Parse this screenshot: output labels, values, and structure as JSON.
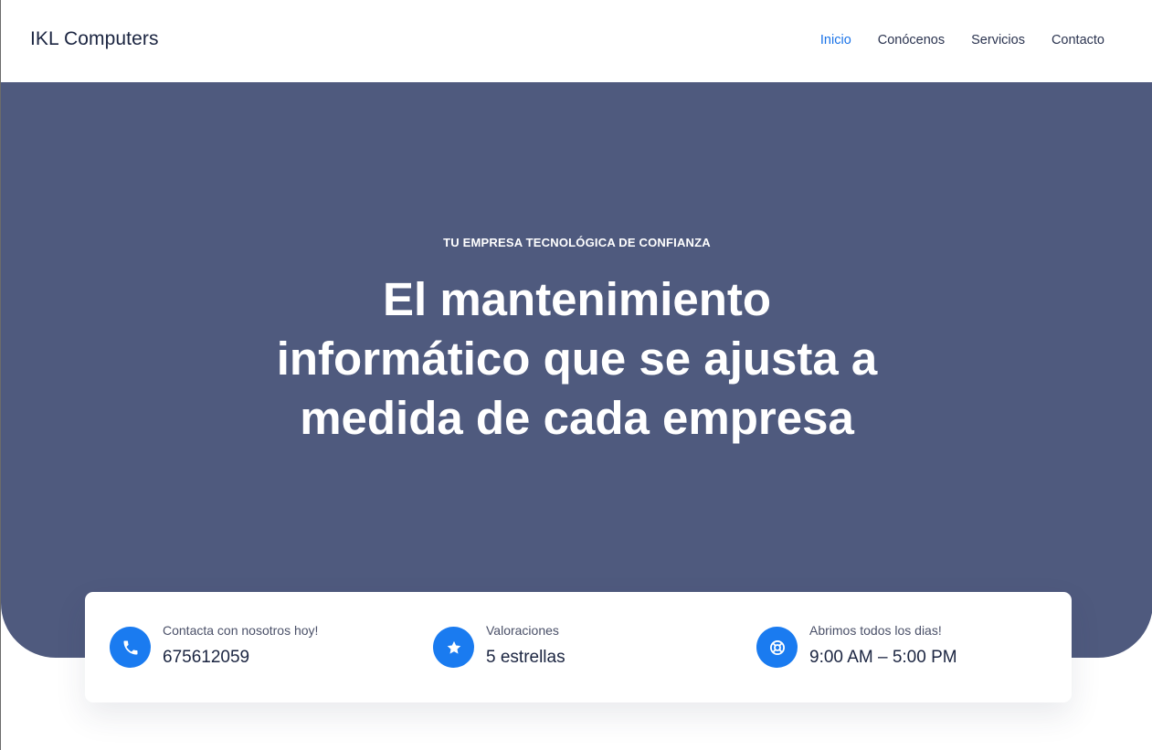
{
  "header": {
    "brand": "IKL Computers",
    "nav": [
      {
        "label": "Inicio",
        "active": true
      },
      {
        "label": "Conócenos",
        "active": false
      },
      {
        "label": "Servicios",
        "active": false
      },
      {
        "label": "Contacto",
        "active": false
      }
    ]
  },
  "hero": {
    "eyebrow": "TU EMPRESA TECNOLÓGICA DE CONFIANZA",
    "title": "El mantenimiento informático que se ajusta a medida de cada empresa"
  },
  "info": [
    {
      "icon": "phone-icon",
      "label": "Contacta con nosotros hoy!",
      "value": "675612059"
    },
    {
      "icon": "star-icon",
      "label": "Valoraciones",
      "value": "5 estrellas"
    },
    {
      "icon": "lifebuoy-icon",
      "label": "Abrimos todos los dias!",
      "value": "9:00 AM – 5:00 PM"
    }
  ],
  "colors": {
    "hero_bg": "#4f5a7e",
    "accent": "#1a7bf0",
    "nav_active": "#1a73e8",
    "text_dark": "#1b2541"
  }
}
